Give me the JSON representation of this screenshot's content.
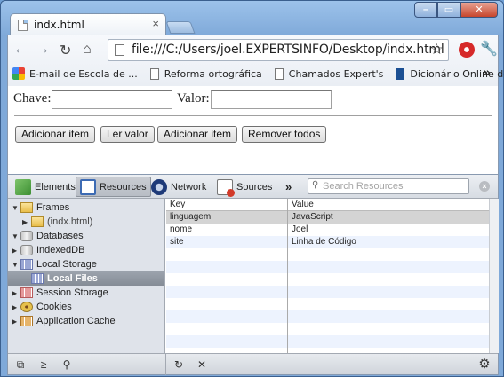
{
  "window": {
    "controls": [
      "–",
      "▭",
      "✕"
    ]
  },
  "tab": {
    "title": "indx.html",
    "close": "×"
  },
  "toolbar": {
    "back": "←",
    "forward": "→",
    "reload": "↻",
    "home": "⌂",
    "url": "file:///C:/Users/joel.EXPERTSINFO/Desktop/indx.html",
    "star": "☆",
    "wrench": "🔧"
  },
  "bookmarks": {
    "items": [
      {
        "label": "E-mail de Escola de ...",
        "icon": "google-icon"
      },
      {
        "label": "Reforma ortográfica",
        "icon": "page-icon"
      },
      {
        "label": "Chamados Expert's",
        "icon": "page-icon"
      },
      {
        "label": "Dicionário Online de...",
        "icon": "flag-icon"
      }
    ],
    "more": "»"
  },
  "page": {
    "chave_label": "Chave:",
    "valor_label": "Valor:",
    "chave_value": "",
    "valor_value": "",
    "buttons": [
      "Adicionar item",
      "Ler valor",
      "Adicionar item",
      "Remover todos"
    ]
  },
  "devtools": {
    "tabs": [
      "Elements",
      "Resources",
      "Network",
      "Sources"
    ],
    "more": "»",
    "search_placeholder": "Search Resources",
    "tree": [
      {
        "label": "Frames",
        "arrow": "▼"
      },
      {
        "label": "(indx.html)",
        "arrow": "▶"
      },
      {
        "label": "Databases",
        "arrow": "▼"
      },
      {
        "label": "IndexedDB",
        "arrow": "▶"
      },
      {
        "label": "Local Storage",
        "arrow": "▼"
      },
      {
        "label": "Local Files",
        "arrow": ""
      },
      {
        "label": "Session Storage",
        "arrow": "▶"
      },
      {
        "label": "Cookies",
        "arrow": "▶"
      },
      {
        "label": "Application Cache",
        "arrow": "▶"
      }
    ],
    "table": {
      "headers": [
        "Key",
        "Value"
      ],
      "rows": [
        {
          "key": "linguagem",
          "value": "JavaScript"
        },
        {
          "key": "nome",
          "value": "Joel"
        },
        {
          "key": "site",
          "value": "Linha de Código"
        }
      ]
    },
    "status": {
      "dock": "⧉",
      "console": "≥",
      "search": "⚲",
      "refresh": "↻",
      "delete": "✕",
      "settings": "⚙"
    }
  }
}
